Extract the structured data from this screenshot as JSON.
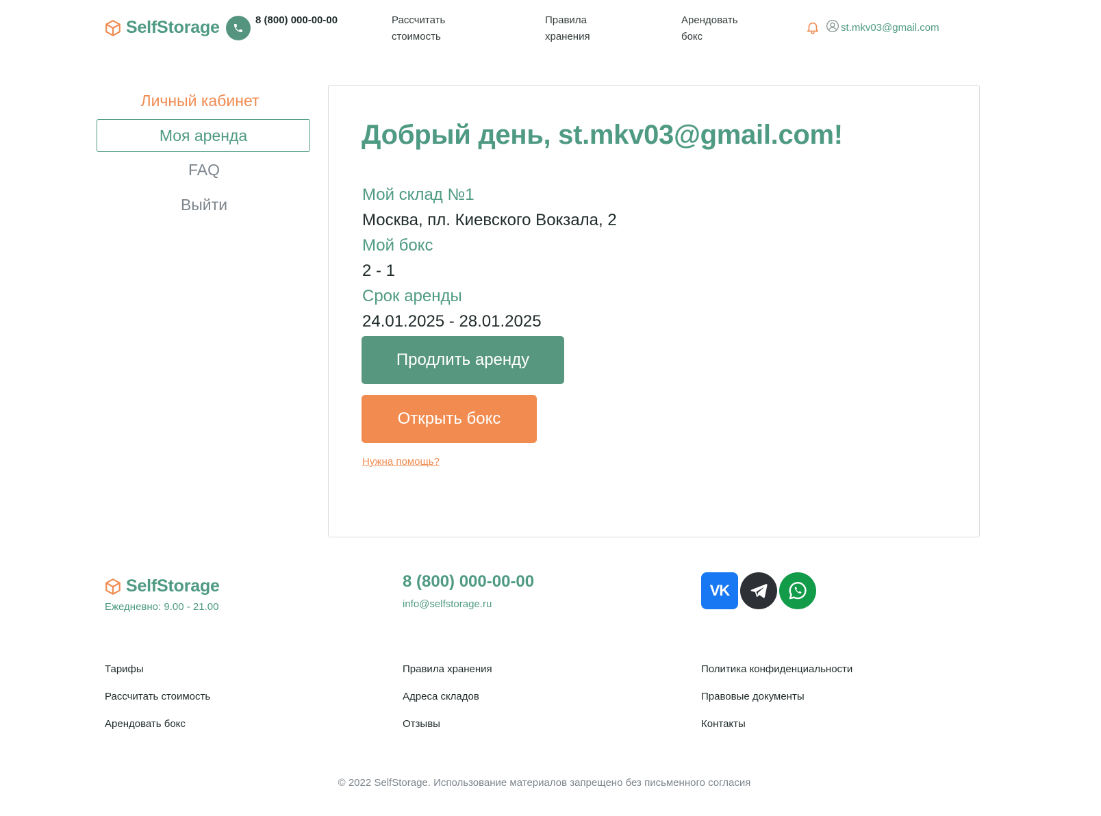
{
  "header": {
    "brand": "SelfStorage",
    "phone": "8 (800) 000-00-00",
    "nav": [
      {
        "label": "Рассчитать стоимость"
      },
      {
        "label": "Правила хранения"
      },
      {
        "label": "Арендовать бокс"
      }
    ],
    "user_email": "st.mkv03@gmail.com",
    "icons": {
      "logo": "box-icon",
      "phone": "phone-icon",
      "bell": "bell-icon",
      "user": "user-icon"
    }
  },
  "sidebar": {
    "title": "Личный кабинет",
    "items": [
      {
        "label": "Моя аренда",
        "active": true
      },
      {
        "label": "FAQ",
        "active": false
      },
      {
        "label": "Выйти",
        "active": false
      }
    ]
  },
  "main": {
    "greeting": "Добрый день, st.mkv03@gmail.com!",
    "warehouse_label": "Мой склад №1",
    "warehouse_address": "Москва, пл. Киевского Вокзала, 2",
    "box_label": "Мой бокс",
    "box_value": "2 - 1",
    "term_label": "Срок аренды",
    "term_value": "24.01.2025 - 28.01.2025",
    "extend_button": "Продлить аренду",
    "open_button": "Открыть бокс",
    "help_link": "Нужна помощь?"
  },
  "footer": {
    "brand": "SelfStorage",
    "hours": "Ежедневно: 9.00 - 21.00",
    "phone": "8 (800) 000-00-00",
    "email": "info@selfstorage.ru",
    "socials": [
      "vk-icon",
      "telegram-icon",
      "whatsapp-icon"
    ],
    "vk_text": "VK",
    "links_col1": [
      "Тарифы",
      "Рассчитать стоимость",
      "Арендовать бокс"
    ],
    "links_col2": [
      "Правила хранения",
      "Адреса складов",
      "Отзывы"
    ],
    "links_col3": [
      "Политика конфиденциальности",
      "Правовые документы",
      "Контакты"
    ],
    "copyright": "© 2022 SelfStorage. Использование материалов запрещено без письменного согласия"
  },
  "colors": {
    "accent_green": "#4f9a83",
    "accent_orange": "#f28b4f",
    "muted_gray": "#7d858d",
    "vk_blue": "#1877f2",
    "telegram_dark": "#2d3035",
    "whatsapp_green": "#129b49"
  }
}
